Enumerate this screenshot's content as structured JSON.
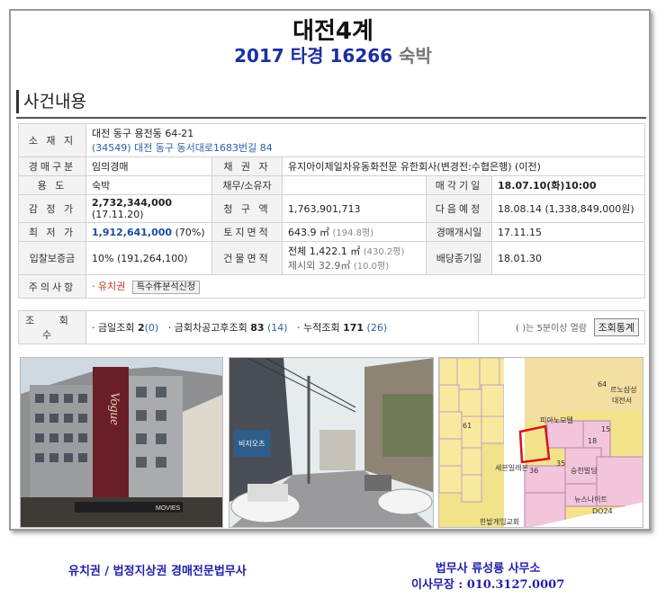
{
  "header": {
    "title": "대전4계",
    "case_no": "2017 타경 16266",
    "case_kind": "숙박"
  },
  "section": {
    "title": "사건내용"
  },
  "info": {
    "location_label": "소 재 지",
    "location_line1": "대전 동구 용전동 64-21",
    "location_line2": "(34549) 대전 동구 동서대로1683번길 84",
    "auction_type_label": "경매구분",
    "auction_type": "임의경매",
    "creditor_label": "채 권 자",
    "creditor": "유지아이제일차유동화전문 유한회사(변경전:수협은행) (이전)",
    "usage_label": "용 도",
    "usage": "숙박",
    "debtor_label": "채무/소유자",
    "debtor": "",
    "sale_date_label": "매각기일",
    "sale_date": "18.07.10(화)10:00",
    "appraisal_label": "감 정 가",
    "appraisal_value": "2,732,344,000",
    "appraisal_date": "(17.11.20)",
    "claim_label": "청 구 액",
    "claim": "1,763,901,713",
    "next_label": "다음예정",
    "next": "18.08.14 (1,338,849,000원)",
    "min_price_label": "최 저 가",
    "min_price_value": "1,912,641,000",
    "min_price_pct": "(70%)",
    "land_label": "토지면적",
    "land_area": "643.9 ㎡",
    "land_pyeong": "(194.8평)",
    "start_label": "경매개시일",
    "start": "17.11.15",
    "deposit_label": "입찰보증금",
    "deposit": "10% (191,264,100)",
    "building_label": "건물면적",
    "building_total": "전체 1,422.1 ㎡",
    "building_total_pyeong": "(430.2평)",
    "building_excl": "제시외 32.9㎡",
    "building_excl_pyeong": "(10.0평)",
    "dividend_label": "배당종기일",
    "dividend": "18.01.30",
    "notes_label": "주의사항",
    "notes_lien": "· 유치권",
    "notes_button": "특수件분석신청"
  },
  "views": {
    "label": "조 회 수",
    "today_label": "· 금일조회",
    "today": "2",
    "today_paren": "(0)",
    "after_label": "· 금회차공고후조회",
    "after": "83",
    "after_paren": "(14)",
    "total_label": "· 누적조회",
    "total": "171",
    "total_paren": "(26)",
    "note": "( )는 5분이상 열람",
    "stats_button": "조회통계"
  },
  "photos": {
    "photo1_sign1": "Vogue",
    "photo1_sign2": "MOVIES",
    "photo2_sign": "비지오즈",
    "map_labels": [
      "피아노모텔",
      "르노삼성",
      "대전서",
      "승천빌딩",
      "세븐일레븐",
      "뉴스나이트",
      "DO24",
      "한밭게임교회",
      "64",
      "61",
      "36",
      "35",
      "18",
      "15"
    ]
  },
  "footer": {
    "left": "유치권 / 법정지상권 경매전문법무사",
    "right_line1": "법무사 류성룡 사무소",
    "right_line2": "이사무장 : 010.3127.0007"
  }
}
